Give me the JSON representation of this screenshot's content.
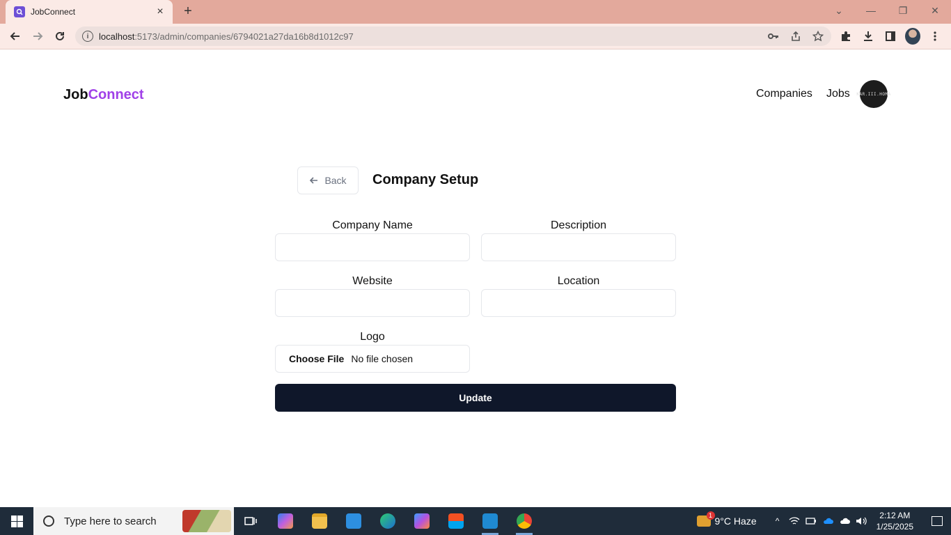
{
  "browser": {
    "tab_title": "JobConnect",
    "url_host": "localhost",
    "url_path": ":5173/admin/companies/6794021a27da16b8d1012c97",
    "new_tab_label": "+"
  },
  "navbar": {
    "brand_part1": "Job",
    "brand_part2": "Connect",
    "brand_accent_color": "#a040e8",
    "links": [
      "Companies",
      "Jobs"
    ],
    "avatar_text": "KAR.III.HOMA"
  },
  "setup": {
    "back_label": "Back",
    "title": "Company Setup",
    "fields": {
      "company_name": {
        "label": "Company Name",
        "value": ""
      },
      "description": {
        "label": "Description",
        "value": ""
      },
      "website": {
        "label": "Website",
        "value": ""
      },
      "location": {
        "label": "Location",
        "value": ""
      },
      "logo": {
        "label": "Logo",
        "button": "Choose File",
        "status": "No file chosen"
      }
    },
    "submit_label": "Update",
    "submit_color": "#0f172a"
  },
  "taskbar": {
    "search_placeholder": "Type here to search",
    "weather_text": "9°C  Haze",
    "weather_badge": "1",
    "time": "2:12 AM",
    "date": "1/25/2025"
  }
}
